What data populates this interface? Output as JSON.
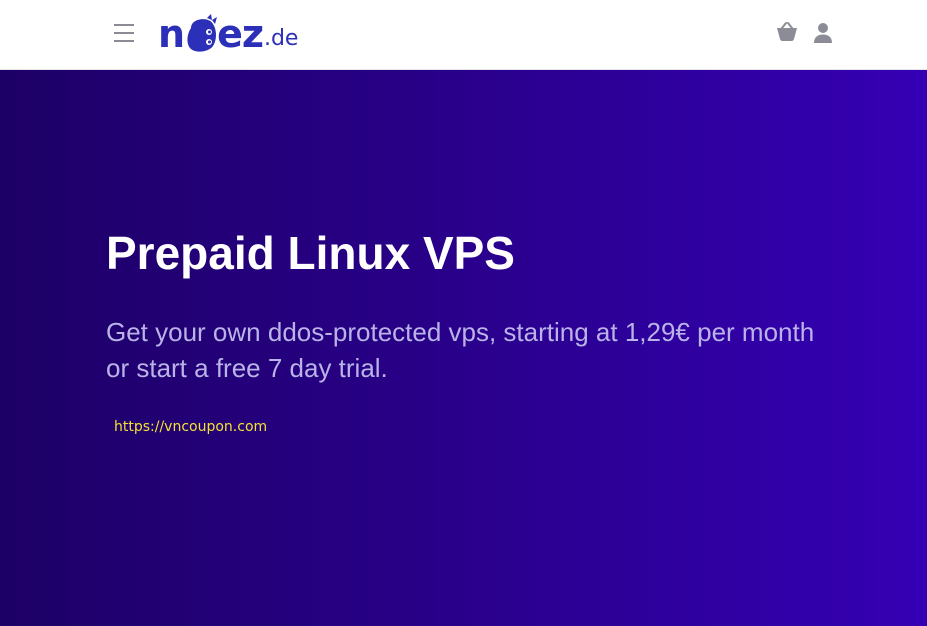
{
  "header": {
    "logo": {
      "name_part1": "n",
      "name_part2": "ez",
      "tld": ".de"
    },
    "icons": {
      "menu": "hamburger-menu-icon",
      "cart": "basket-icon",
      "account": "user-icon"
    },
    "colors": {
      "brand": "#2c2fb8",
      "icon": "#8c8c96"
    }
  },
  "hero": {
    "title": "Prepaid Linux VPS",
    "subtitle": "Get your own ddos-protected vps, starting at 1,29€ per month or start a free 7 day trial.",
    "watermark": "https://vncoupon.com",
    "colors": {
      "gradient_start": "#1d0066",
      "gradient_end": "#3500b4",
      "title": "#ffffff",
      "subtitle": "#b9b3e8"
    }
  }
}
